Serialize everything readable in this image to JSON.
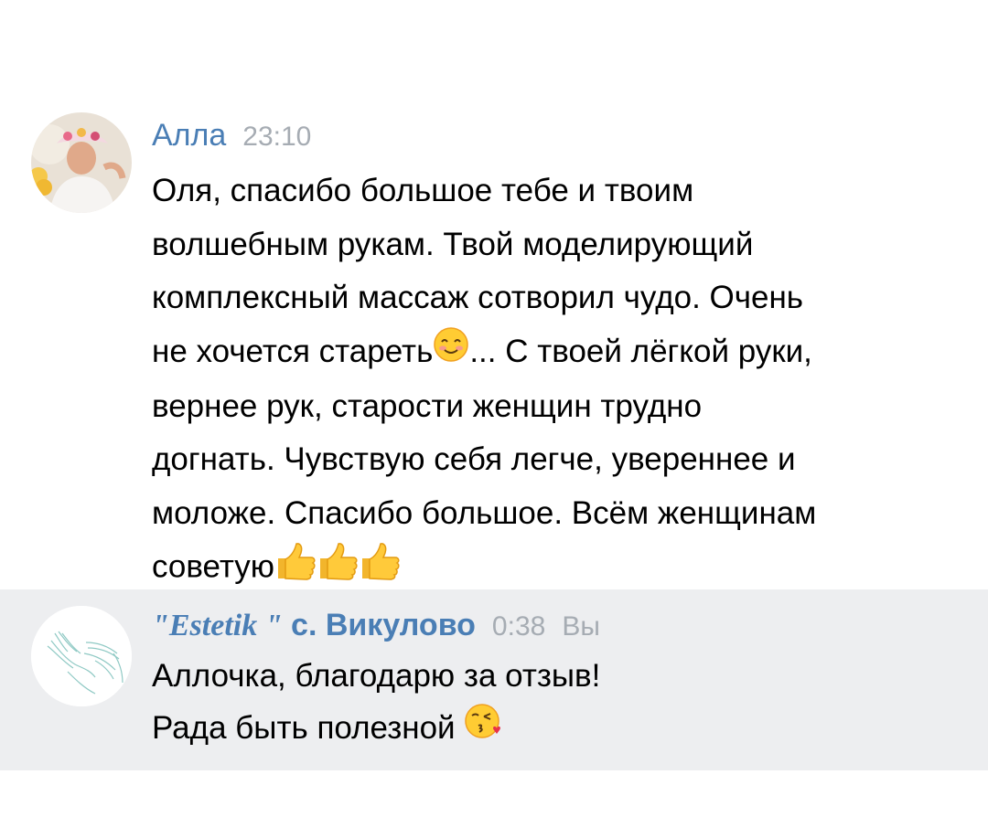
{
  "messages": [
    {
      "author": "Алла",
      "time": "23:10",
      "lines": [
        "Оля, спасибо большое тебе и твоим",
        "волшебным рукам. Твой моделирующий",
        "комплексный массаж сотворил чудо. Очень",
        "не хочется стареть",
        "... С твоей лёгкой руки,",
        "вернее рук, старости женщин трудно",
        "догнать. Чувствую себя легче, увереннее и",
        "моложе. Спасибо большое. Всём женщинам",
        "советую"
      ],
      "emojis": [
        "smiling-face-emoji",
        "thumbs-up-emoji",
        "thumbs-up-emoji",
        "thumbs-up-emoji"
      ]
    },
    {
      "author_prefix": "\"Estetik \"",
      "author": " с. Викулово",
      "time": "0:38",
      "you_label": "Вы",
      "lines": [
        "Аллочка, благодарю за отзыв!",
        "Рада быть полезной"
      ],
      "emojis": [
        "face-blowing-kiss-emoji"
      ]
    }
  ],
  "colors": {
    "link": "#4a7eb5",
    "time": "#a6acb3",
    "own_message_bg": "#edeef0"
  }
}
